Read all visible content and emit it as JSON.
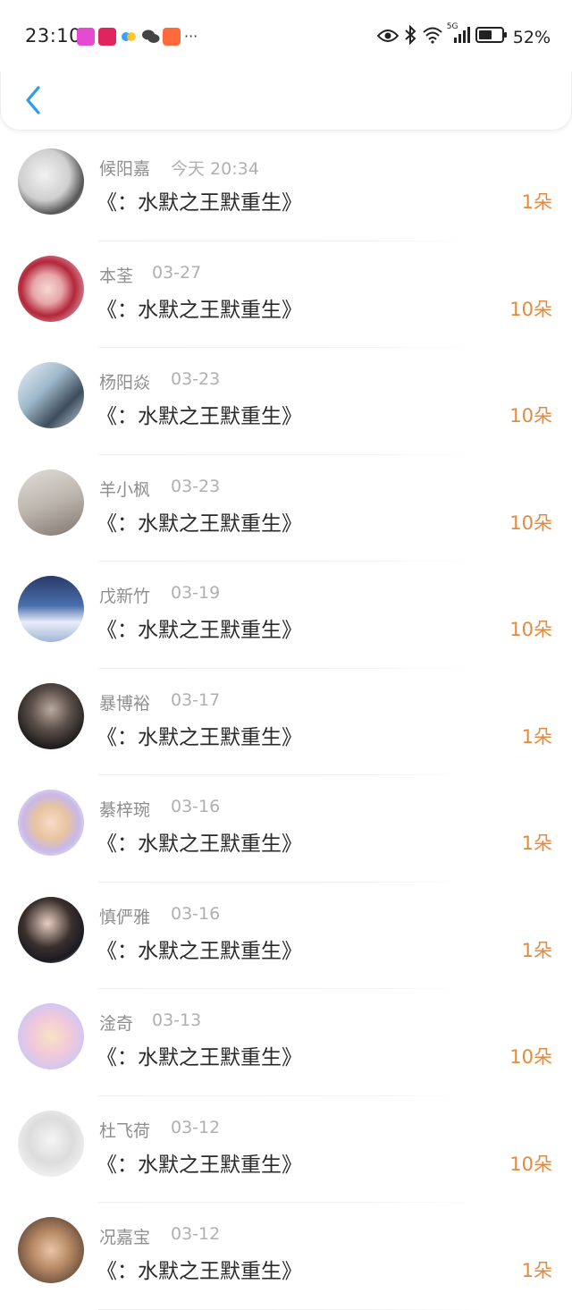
{
  "status_bar": {
    "time": "23:10",
    "more_indicator": "···",
    "battery_percent": "52%",
    "network": "5G",
    "icons": [
      "eye-icon",
      "bluetooth-icon",
      "wifi-icon",
      "signal-icon",
      "battery-icon"
    ]
  },
  "header": {
    "back_icon": "chevron-left-icon"
  },
  "colors": {
    "accent": "#2b9af3",
    "amount": "#e8893a",
    "name": "#8e8e8e",
    "date": "#b0b0b0"
  },
  "records": [
    {
      "name": "候阳嘉",
      "date": "今天 20:34",
      "book": "《：水默之王默重生》",
      "amount": "1朵"
    },
    {
      "name": "本荃",
      "date": "03-27",
      "book": "《：水默之王默重生》",
      "amount": "10朵"
    },
    {
      "name": "杨阳焱",
      "date": "03-23",
      "book": "《：水默之王默重生》",
      "amount": "10朵"
    },
    {
      "name": "羊小枫",
      "date": "03-23",
      "book": "《：水默之王默重生》",
      "amount": "10朵"
    },
    {
      "name": "戊新竹",
      "date": "03-19",
      "book": "《：水默之王默重生》",
      "amount": "10朵"
    },
    {
      "name": "暴博裕",
      "date": "03-17",
      "book": "《：水默之王默重生》",
      "amount": "1朵"
    },
    {
      "name": "綦梓琬",
      "date": "03-16",
      "book": "《：水默之王默重生》",
      "amount": "1朵"
    },
    {
      "name": "慎俨雅",
      "date": "03-16",
      "book": "《：水默之王默重生》",
      "amount": "1朵"
    },
    {
      "name": "淦奇",
      "date": "03-13",
      "book": "《：水默之王默重生》",
      "amount": "10朵"
    },
    {
      "name": "杜飞荷",
      "date": "03-12",
      "book": "《：水默之王默重生》",
      "amount": "10朵"
    },
    {
      "name": "况嘉宝",
      "date": "03-12",
      "book": "《：水默之王默重生》",
      "amount": "1朵"
    }
  ]
}
